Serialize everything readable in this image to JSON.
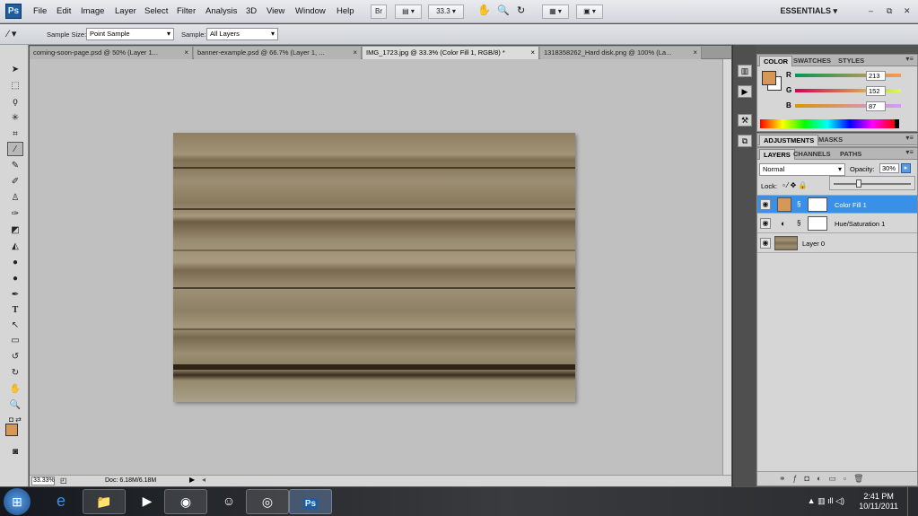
{
  "app": {
    "logo": "Ps"
  },
  "menu": [
    "File",
    "Edit",
    "Image",
    "Layer",
    "Select",
    "Filter",
    "Analysis",
    "3D",
    "View",
    "Window",
    "Help"
  ],
  "menubar_widgets": {
    "br_label": "Br",
    "zoom": "33.3",
    "workspace": "ESSENTIALS",
    "min": "–",
    "restore": "⧉",
    "close": "✕"
  },
  "options": {
    "sample_size_label": "Sample Size:",
    "sample_size_value": "Point Sample",
    "sample_label": "Sample:",
    "sample_value": "All Layers"
  },
  "tabs": [
    {
      "label": "coming-soon-page.psd @ 50% (Layer 1...",
      "close": "×"
    },
    {
      "label": "banner-example.psd @ 66.7% (Layer 1, ...",
      "close": "×"
    },
    {
      "label": "IMG_1723.jpg @ 33.3% (Color Fill 1, RGB/8) *",
      "close": "×"
    },
    {
      "label": "1318358262_Hard disk.png @ 100% (La...",
      "close": "×"
    }
  ],
  "status": {
    "zoom": "33.33%",
    "doc": "Doc: 6.18M/6.18M"
  },
  "color_panel": {
    "tabs": [
      "COLOR",
      "SWATCHES",
      "STYLES"
    ],
    "channels": [
      {
        "name": "R",
        "value": "213"
      },
      {
        "name": "G",
        "value": "152"
      },
      {
        "name": "B",
        "value": "87"
      }
    ],
    "foreground": "#d59857"
  },
  "adjustments_panel": {
    "tabs": [
      "ADJUSTMENTS",
      "MASKS"
    ]
  },
  "layers_panel": {
    "tabs": [
      "LAYERS",
      "CHANNELS",
      "PATHS"
    ],
    "blend_mode": "Normal",
    "opacity_label": "Opacity:",
    "opacity_value": "30%",
    "lock_label": "Lock:",
    "layers": [
      {
        "name": "Color Fill 1",
        "active": true
      },
      {
        "name": "Hue/Saturation 1",
        "active": false
      },
      {
        "name": "Layer 0",
        "active": false
      }
    ]
  },
  "taskbar": {
    "time": "2:41 PM",
    "date": "10/11/2011"
  }
}
